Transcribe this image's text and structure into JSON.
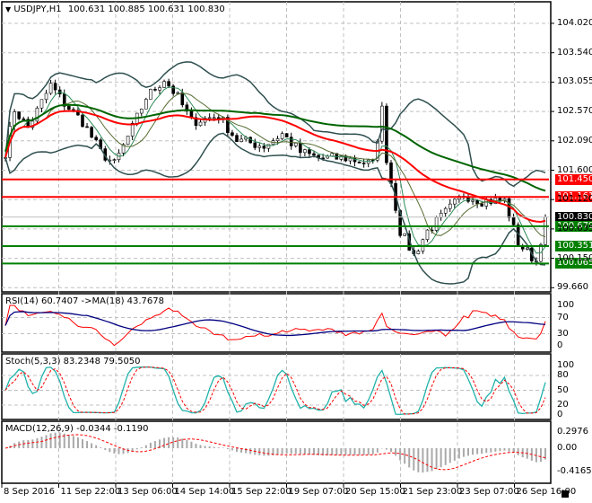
{
  "header": {
    "arrow_icon": "triangle-down-icon",
    "symbol": "USDJPY,H1",
    "ohlc": "100.631 100.885 100.631 100.830"
  },
  "panels": {
    "rsi": {
      "title": "RSI(14) 60.7407  ->MA(18) 43.7678",
      "ticks": [
        "100",
        "70",
        "30",
        "0"
      ]
    },
    "stoch": {
      "title": "Stoch(5,3,3) 83.2348 79.5050",
      "ticks": [
        "100",
        "80",
        "50",
        "20",
        "0"
      ]
    },
    "macd": {
      "title": "MACD(12,26,9) -0.0344 -0.1190",
      "ticks": [
        "0.2976",
        "0.00",
        "-0.4165"
      ]
    }
  },
  "price_axis": [
    "104.020",
    "103.540",
    "103.055",
    "102.570",
    "102.090",
    "101.600",
    "101.120",
    "100.635",
    "100.150",
    "99.660"
  ],
  "levels": [
    {
      "label": "101.450",
      "value": 101.45,
      "color": "#ff0000"
    },
    {
      "label": "101.161",
      "value": 101.161,
      "color": "#ff0000"
    },
    {
      "label": "100.830",
      "value": 100.83,
      "color": "#000000"
    },
    {
      "label": "100.679",
      "value": 100.679,
      "color": "#007f00"
    },
    {
      "label": "100.351",
      "value": 100.351,
      "color": "#007f00"
    },
    {
      "label": "100.065",
      "value": 100.065,
      "color": "#007f00"
    }
  ],
  "time_axis": [
    "8 Sep 2016",
    "11 Sep 22:00",
    "13 Sep 06:00",
    "14 Sep 14:00",
    "15 Sep 22:00",
    "19 Sep 07:00",
    "20 Sep 15:00",
    "21 Sep 23:00",
    "23 Sep 07:00",
    "26 Sep 16:00"
  ],
  "chart_data": {
    "type": "line",
    "title": "USDJPY,H1",
    "ylim": [
      99.66,
      104.02
    ],
    "close_keypoints": [
      [
        0,
        101.9
      ],
      [
        2,
        102.6
      ],
      [
        5,
        102.3
      ],
      [
        10,
        103.0
      ],
      [
        13,
        102.7
      ],
      [
        17,
        102.4
      ],
      [
        21,
        101.9
      ],
      [
        24,
        101.7
      ],
      [
        28,
        102.3
      ],
      [
        31,
        102.8
      ],
      [
        35,
        103.1
      ],
      [
        38,
        102.8
      ],
      [
        41,
        102.4
      ],
      [
        47,
        102.5
      ],
      [
        51,
        102.1
      ],
      [
        57,
        102.0
      ],
      [
        61,
        102.2
      ],
      [
        65,
        101.9
      ],
      [
        69,
        101.8
      ],
      [
        75,
        101.8
      ],
      [
        81,
        101.7
      ],
      [
        83,
        102.6
      ],
      [
        84,
        101.8
      ],
      [
        87,
        100.6
      ],
      [
        90,
        100.2
      ],
      [
        93,
        100.6
      ],
      [
        97,
        100.9
      ],
      [
        101,
        101.2
      ],
      [
        105,
        101.1
      ],
      [
        110,
        101.1
      ],
      [
        113,
        100.4
      ],
      [
        117,
        100.1
      ],
      [
        119,
        100.83
      ]
    ],
    "bars": 120
  }
}
